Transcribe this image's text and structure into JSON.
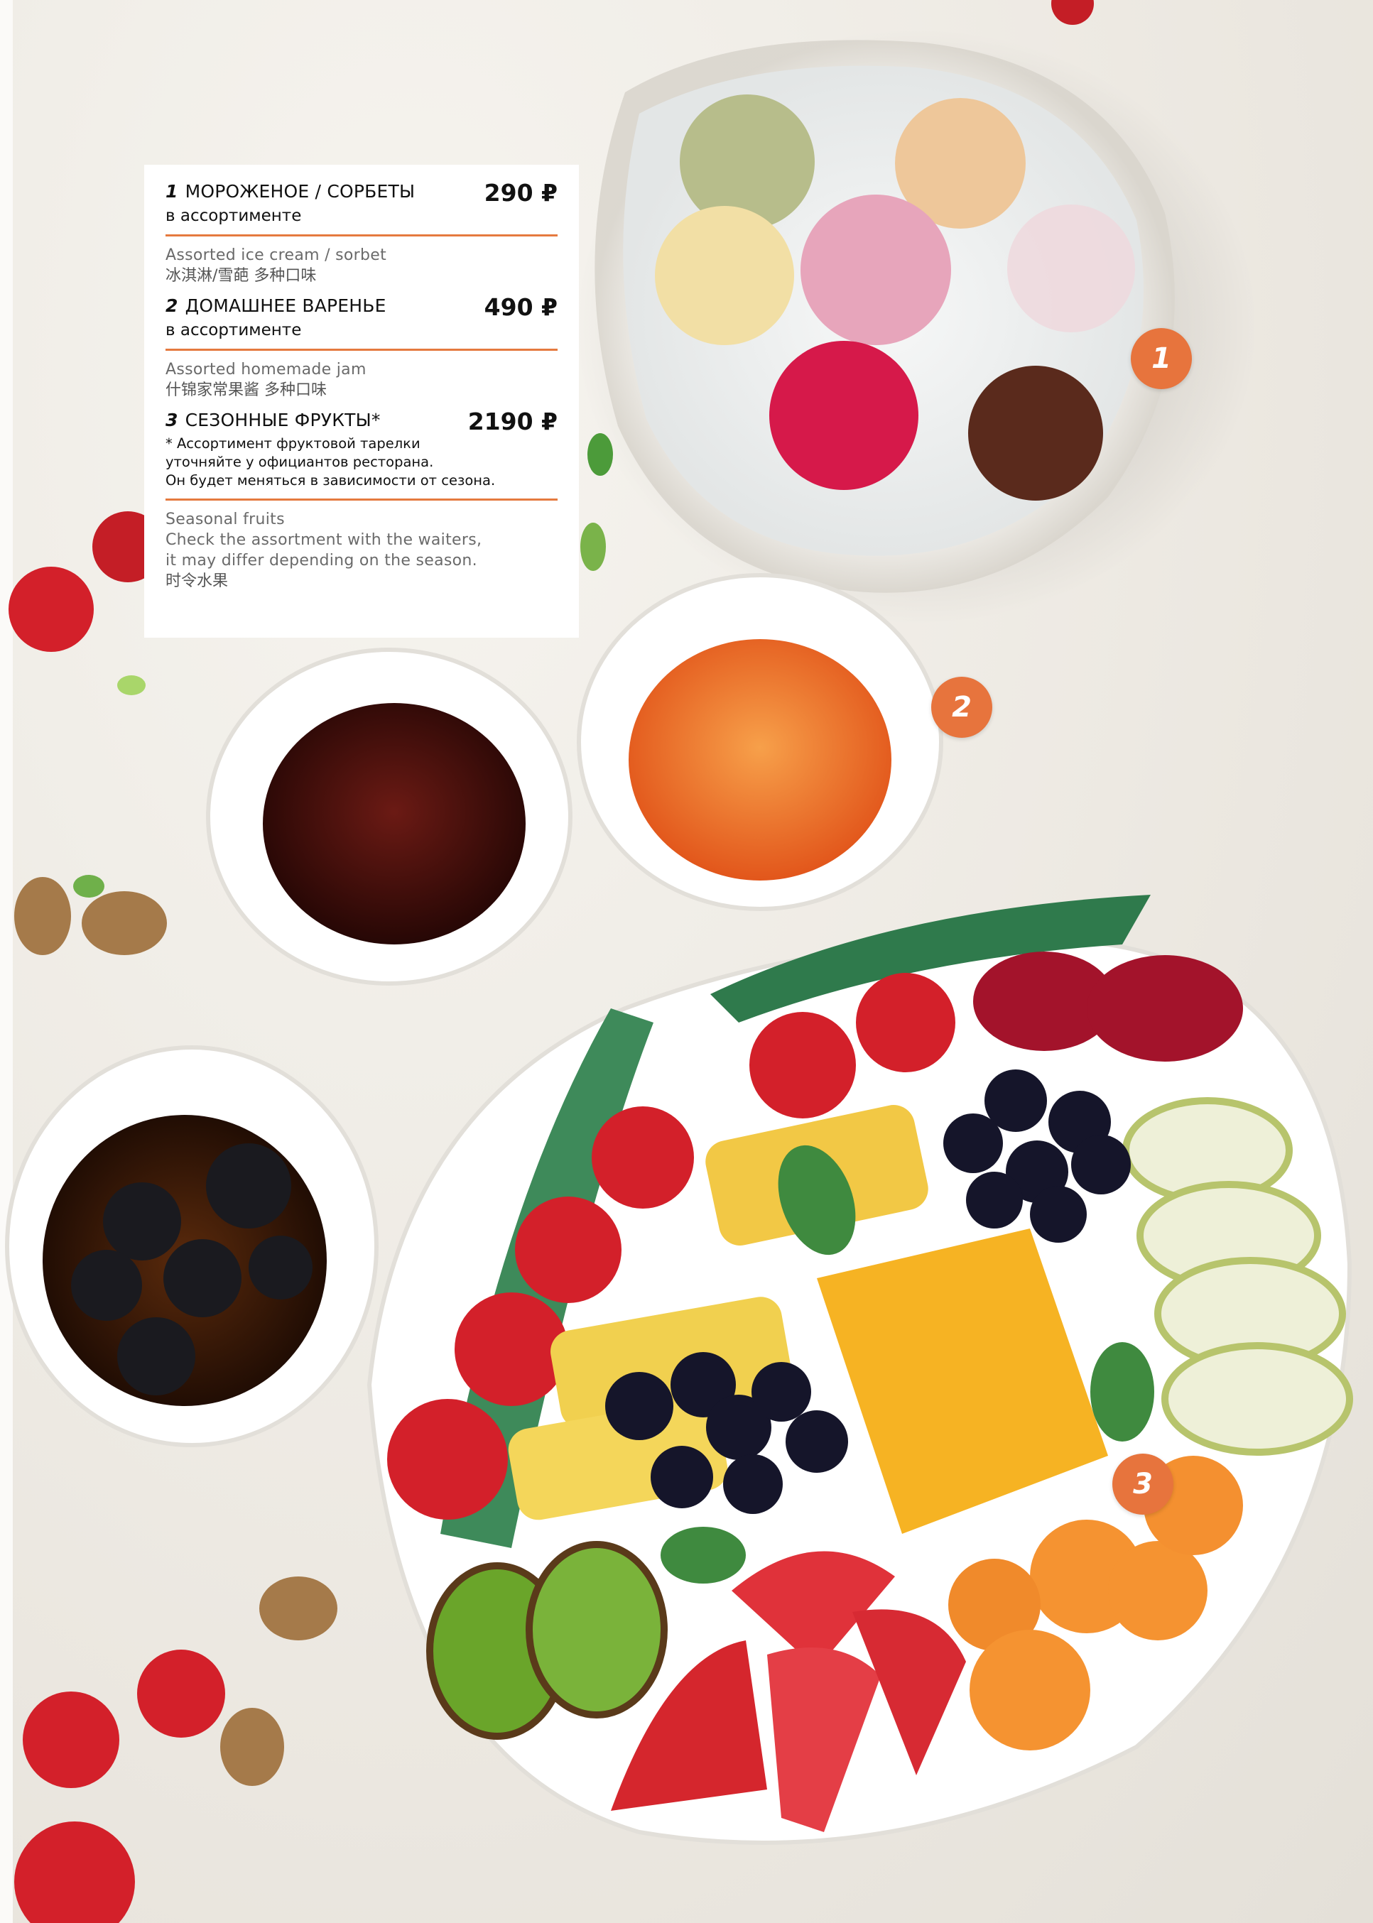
{
  "menu": {
    "items": [
      {
        "number": "1",
        "title": "МОРОЖЕНОЕ / СОРБЕТЫ",
        "price": "290 ₽",
        "subtitle": "в ассортименте",
        "note": "",
        "english": "Assorted ice cream / sorbet",
        "english_2": "",
        "english_3": "",
        "chinese": "冰淇淋/雪葩 多种口味"
      },
      {
        "number": "2",
        "title": "ДОМАШНЕЕ ВАРЕНЬЕ",
        "price": "490 ₽",
        "subtitle": "в ассортименте",
        "note": "",
        "english": "Assorted homemade jam",
        "english_2": "",
        "english_3": "",
        "chinese": "什锦家常果酱 多种口味"
      },
      {
        "number": "3",
        "title": "СЕЗОННЫЕ ФРУКТЫ*",
        "price": "2190 ₽",
        "subtitle": "",
        "note_1": "* Ассортимент фруктовой тарелки",
        "note_2": "уточняйте у официантов ресторана.",
        "note_3": "Он будет меняться в зависимости от сезона.",
        "english": "Seasonal fruits",
        "english_2": "Check the assortment with the waiters,",
        "english_3": "it may differ depending on the season.",
        "chinese": "时令水果"
      }
    ]
  },
  "badges": [
    "1",
    "2",
    "3"
  ],
  "colors": {
    "accent": "#e7743d",
    "rule": "#e57a3f",
    "card": "#ffffff"
  }
}
